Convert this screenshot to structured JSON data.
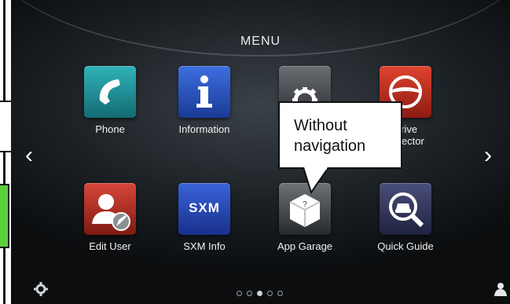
{
  "menu": {
    "title": "MENU"
  },
  "tiles": [
    {
      "label": "Phone",
      "icon": "phone-handset-icon"
    },
    {
      "label": "Information",
      "icon": "info-icon"
    },
    {
      "label": "Settings",
      "icon": "gear-icon"
    },
    {
      "label": "Drive\nSelector",
      "icon": "steering-wheel-icon"
    },
    {
      "label": "Edit User",
      "icon": "user-edit-icon"
    },
    {
      "label": "SXM Info",
      "icon": "sxm-logo-icon"
    },
    {
      "label": "App Garage",
      "icon": "app-box-icon"
    },
    {
      "label": "Quick Guide",
      "icon": "car-magnifier-icon"
    }
  ],
  "sxm_text": "SXM",
  "callout": {
    "text": "Without navigation"
  },
  "pagination": {
    "pages": 5,
    "current": 3
  },
  "colors": {
    "green_indicator": "#5ad13a",
    "menu_text": "#e9ecef"
  }
}
